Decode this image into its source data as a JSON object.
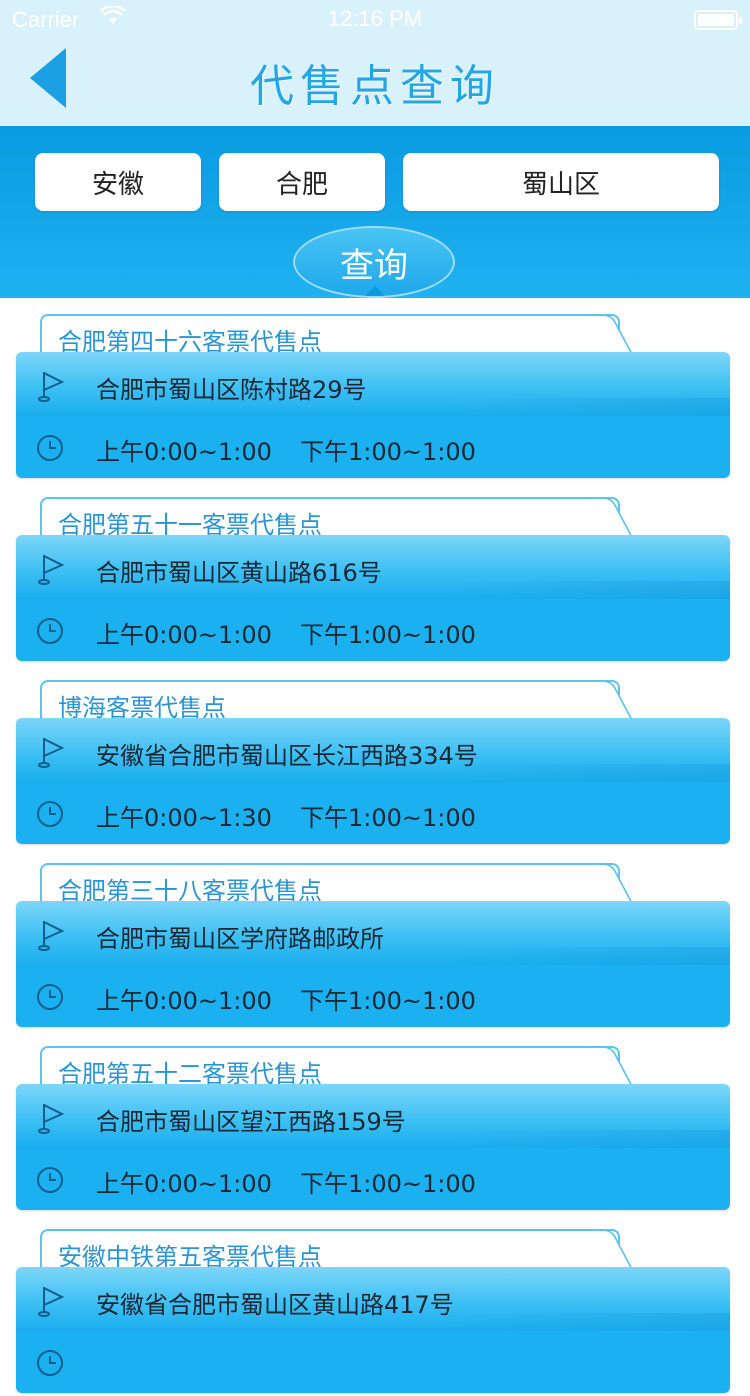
{
  "status_bar": {
    "carrier": "Carrier",
    "time": "12:16 PM"
  },
  "nav": {
    "title": "代售点查询"
  },
  "filters": {
    "province": "安徽",
    "city": "合肥",
    "district": "蜀山区",
    "query_button": "查询"
  },
  "locations": [
    {
      "name": "合肥第四十六客票代售点",
      "address": "合肥市蜀山区陈村路29号",
      "am_hours": "上午0:00~1:00",
      "pm_hours": "下午1:00~1:00"
    },
    {
      "name": "合肥第五十一客票代售点",
      "address": "合肥市蜀山区黄山路616号",
      "am_hours": "上午0:00~1:00",
      "pm_hours": "下午1:00~1:00"
    },
    {
      "name": "博海客票代售点",
      "address": "安徽省合肥市蜀山区长江西路334号",
      "am_hours": "上午0:00~1:30",
      "pm_hours": "下午1:00~1:00"
    },
    {
      "name": "合肥第三十八客票代售点",
      "address": "合肥市蜀山区学府路邮政所",
      "am_hours": "上午0:00~1:00",
      "pm_hours": "下午1:00~1:00"
    },
    {
      "name": "合肥第五十二客票代售点",
      "address": "合肥市蜀山区望江西路159号",
      "am_hours": "上午0:00~1:00",
      "pm_hours": "下午1:00~1:00"
    },
    {
      "name": "安徽中铁第五客票代售点",
      "address": "安徽省合肥市蜀山区黄山路417号",
      "am_hours": "",
      "pm_hours": ""
    }
  ],
  "icons": {
    "back": "back-arrow-icon",
    "location": "flag-icon",
    "hours": "clock-icon"
  },
  "colors": {
    "accent": "#1d9fe3",
    "band": "#0a9be0",
    "card": "#1bb0ef"
  }
}
